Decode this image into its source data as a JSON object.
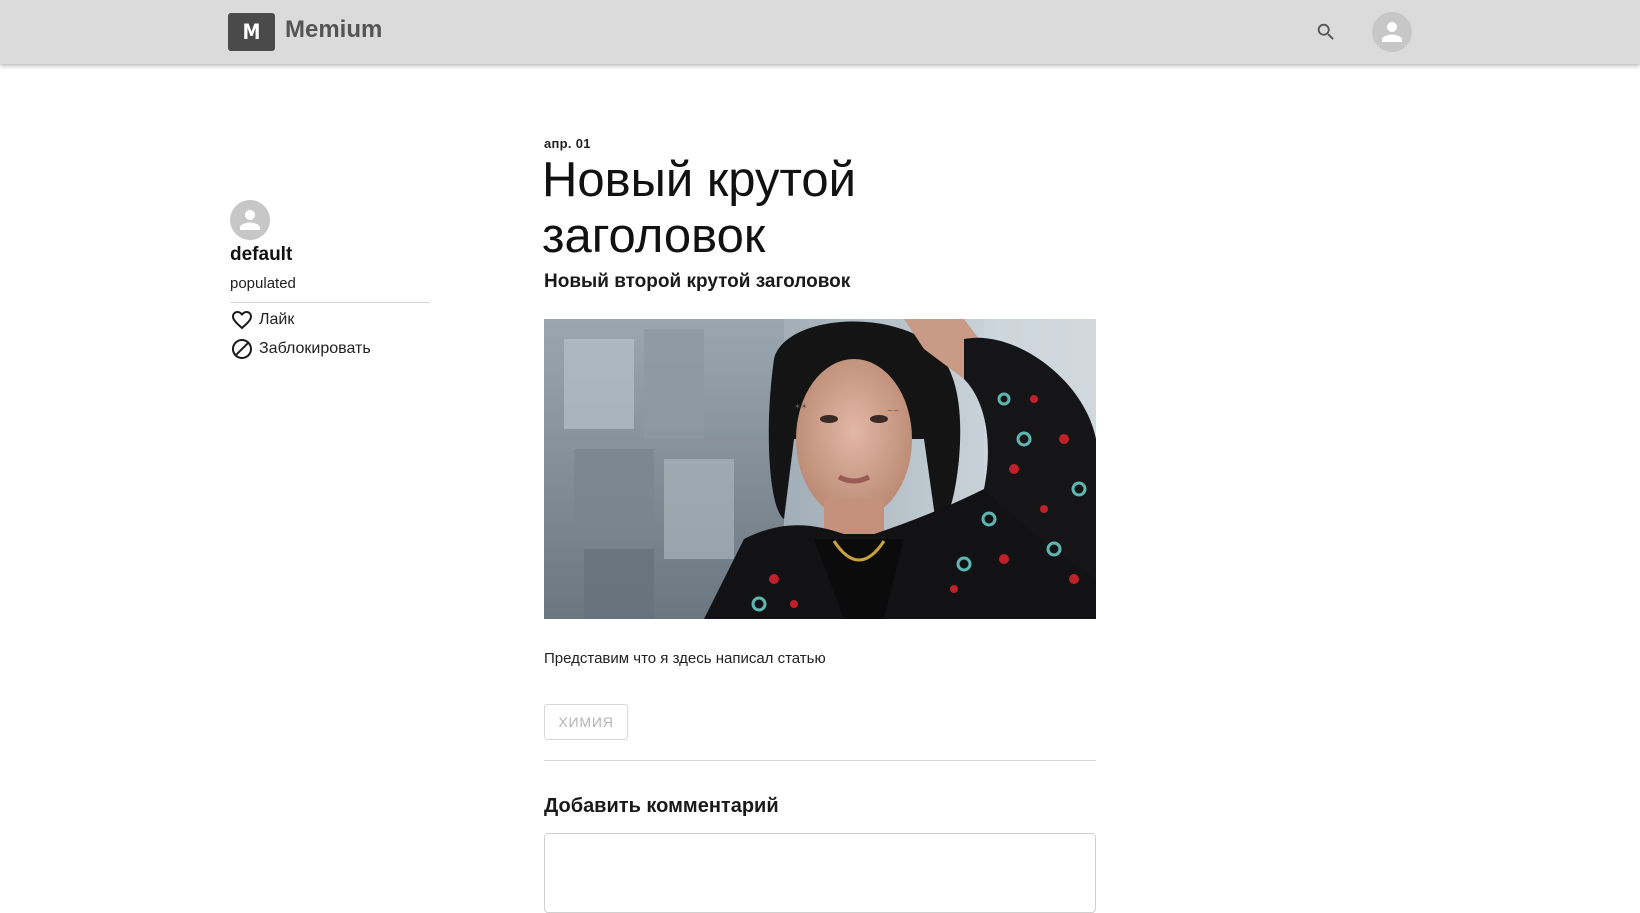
{
  "header": {
    "logo_letter": "M",
    "brand_name": "Memium",
    "search_icon": "search-icon",
    "profile_icon": "user-avatar-icon"
  },
  "author": {
    "avatar_icon": "user-avatar-icon",
    "name": "default",
    "description": "populated",
    "actions": [
      {
        "label": "Лайк",
        "icon": "heart-outline-icon"
      },
      {
        "label": "Заблокировать",
        "icon": "block-icon"
      }
    ]
  },
  "article": {
    "date": "апр. 01",
    "title": "Новый крутой заголовок",
    "subtitle": "Новый второй крутой заголовок",
    "body": "Представим что я здесь написал статью",
    "tags": [
      "ХИМИЯ"
    ]
  },
  "comments": {
    "heading": "Добавить комментарий",
    "input_value": ""
  },
  "colors": {
    "header_bg": "#dcdbdc",
    "logo_bg": "#4a4a4a",
    "brand_text": "#555555",
    "avatar_bg": "#c8c7c8",
    "divider": "#d6d6d6",
    "tag_text": "#b4b4b4"
  }
}
